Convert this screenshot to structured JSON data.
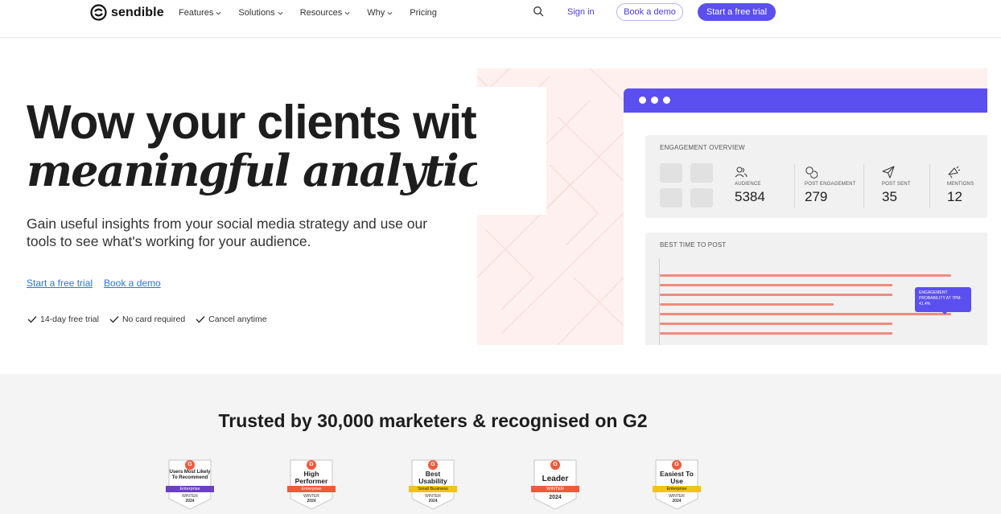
{
  "nav": {
    "logo_text": "sendible",
    "menu": [
      {
        "label": "Features",
        "has_dropdown": true
      },
      {
        "label": "Solutions",
        "has_dropdown": true
      },
      {
        "label": "Resources",
        "has_dropdown": true
      },
      {
        "label": "Why",
        "has_dropdown": true
      },
      {
        "label": "Pricing",
        "has_dropdown": false
      }
    ],
    "search_icon": "search-icon",
    "sign_in": "Sign in",
    "book_demo": "Book a demo",
    "free_trial": "Start a free trial"
  },
  "hero": {
    "title_line1": "Wow your clients with",
    "title_line2": "meaningful analytics.",
    "subtitle": "Gain useful insights from your social media strategy and use our tools to see what's working for your audience.",
    "cta_trial": "Start a free trial",
    "cta_demo": "Book a demo",
    "checks": [
      "14-day free trial",
      "No card required",
      "Cancel anytime"
    ]
  },
  "dashboard": {
    "engagement_title": "ENGAGEMENT OVERVIEW",
    "metrics": [
      {
        "icon": "users-icon",
        "label": "AUDIENCE",
        "value": "5384"
      },
      {
        "icon": "chat-bubbles-icon",
        "label": "POST ENGAGEMENT",
        "value": "279"
      },
      {
        "icon": "send-icon",
        "label": "POST SENT",
        "value": "35"
      },
      {
        "icon": "megaphone-icon",
        "label": "MENTIONS",
        "value": "12"
      }
    ],
    "best_time_title": "BEST TIME TO POST",
    "bars": [
      0.94,
      0.75,
      0.75,
      0.56,
      0.94,
      0.75,
      0.75
    ],
    "tooltip_text": "ENGAGEMENT PROBABILITY AT 7PM: 41.4%"
  },
  "trust": {
    "title": "Trusted by 30,000 marketers & recognised on G2",
    "badges": [
      {
        "g": "G",
        "name": "Users Most Likely To Recommend",
        "ribbon": "Enterprise",
        "ribbon_color": "#6b3fc6",
        "season": "WINTER",
        "year": "2024"
      },
      {
        "g": "G",
        "name": "High Performer",
        "ribbon": "Enterprise",
        "ribbon_color": "#ef5a3c",
        "season": "WINTER",
        "year": "2024"
      },
      {
        "g": "G",
        "name": "Best Usability",
        "ribbon": "Small Business",
        "ribbon_color": "#f2c318",
        "season": "WINTER",
        "year": "2024"
      },
      {
        "g": "G",
        "name": "Leader",
        "ribbon": "WINTER",
        "ribbon_color": "#ef5a3c",
        "season": "",
        "year": "2024"
      },
      {
        "g": "G",
        "name": "Easiest To Use",
        "ribbon": "Enterprise",
        "ribbon_color": "#f2c318",
        "season": "WINTER",
        "year": "2024"
      }
    ]
  }
}
